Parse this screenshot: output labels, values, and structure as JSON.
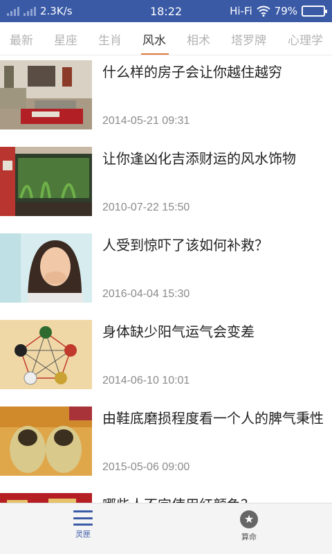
{
  "status_bar": {
    "speed": "2.3K/s",
    "time": "18:22",
    "network": "Hi-Fi",
    "battery_percent": "79%",
    "battery_level": 0.79
  },
  "tabs": [
    {
      "label": "最新",
      "active": false
    },
    {
      "label": "星座",
      "active": false
    },
    {
      "label": "生肖",
      "active": false
    },
    {
      "label": "风水",
      "active": true
    },
    {
      "label": "相术",
      "active": false
    },
    {
      "label": "塔罗牌",
      "active": false
    },
    {
      "label": "心理学",
      "active": false
    }
  ],
  "articles": [
    {
      "title": "什么样的房子会让你越住越穷",
      "date": "2014-05-21 09:31",
      "thumb": "living-room"
    },
    {
      "title": "让你逢凶化吉添财运的风水饰物",
      "date": "2010-07-22 15:50",
      "thumb": "aquarium"
    },
    {
      "title": "人受到惊吓了该如何补救？",
      "date": "2016-04-04 15:30",
      "thumb": "startled-woman"
    },
    {
      "title": "身体缺少阳气运气会变差",
      "date": "2014-06-10 10:01",
      "thumb": "five-elements-chart"
    },
    {
      "title": "由鞋底磨损程度看一个人的脾气秉性",
      "date": "2015-05-06 09:00",
      "thumb": "worn-shoes"
    },
    {
      "title": "哪些人不宜使用红颜色？",
      "date": "",
      "thumb": "red-items"
    }
  ],
  "bottom_nav": {
    "items": [
      {
        "label": "灵匣",
        "icon": "menu-icon",
        "active": true
      },
      {
        "label": "算命",
        "icon": "star-icon",
        "active": false
      }
    ]
  },
  "colors": {
    "status_bar": "#3a5aa6",
    "accent": "#e07a3c",
    "active_nav": "#3a5aa6"
  }
}
